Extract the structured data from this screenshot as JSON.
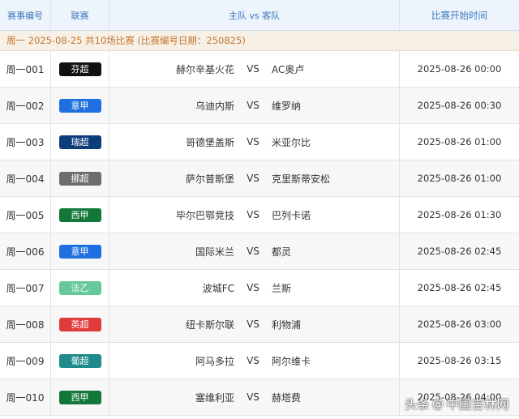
{
  "header": {
    "col_id": "赛事编号",
    "col_league": "联赛",
    "col_teams": "主队 vs 客队",
    "col_time": "比赛开始时间"
  },
  "info_bar": "周一 2025-08-25 共10场比赛 (比赛编号日期：250825)",
  "vs_label": "VS",
  "matches": [
    {
      "id": "周一001",
      "league": "芬超",
      "league_color": "#111111",
      "home": "赫尔辛基火花",
      "away": "AC奥卢",
      "time": "2025-08-26 00:00"
    },
    {
      "id": "周一002",
      "league": "意甲",
      "league_color": "#1f6fe0",
      "home": "乌迪内斯",
      "away": "维罗纳",
      "time": "2025-08-26 00:30"
    },
    {
      "id": "周一003",
      "league": "瑞超",
      "league_color": "#0c3d7a",
      "home": "哥德堡盖斯",
      "away": "米亚尔比",
      "time": "2025-08-26 01:00"
    },
    {
      "id": "周一004",
      "league": "挪超",
      "league_color": "#6d6d6d",
      "home": "萨尔普斯堡",
      "away": "克里斯蒂安松",
      "time": "2025-08-26 01:00"
    },
    {
      "id": "周一005",
      "league": "西甲",
      "league_color": "#13773a",
      "home": "毕尔巴鄂竞技",
      "away": "巴列卡诺",
      "time": "2025-08-26 01:30"
    },
    {
      "id": "周一006",
      "league": "意甲",
      "league_color": "#1f6fe0",
      "home": "国际米兰",
      "away": "都灵",
      "time": "2025-08-26 02:45"
    },
    {
      "id": "周一007",
      "league": "法乙",
      "league_color": "#66c99a",
      "home": "波城FC",
      "away": "兰斯",
      "time": "2025-08-26 02:45"
    },
    {
      "id": "周一008",
      "league": "英超",
      "league_color": "#e03b3b",
      "home": "纽卡斯尔联",
      "away": "利物浦",
      "time": "2025-08-26 03:00"
    },
    {
      "id": "周一009",
      "league": "葡超",
      "league_color": "#1e8a8a",
      "home": "阿马多拉",
      "away": "阿尔维卡",
      "time": "2025-08-26 03:15"
    },
    {
      "id": "周一010",
      "league": "西甲",
      "league_color": "#13773a",
      "home": "塞维利亚",
      "away": "赫塔费",
      "time": "2025-08-26 04:00"
    }
  ],
  "watermark": {
    "prefix": "头条",
    "at": "@",
    "name": "中国吉林网"
  }
}
